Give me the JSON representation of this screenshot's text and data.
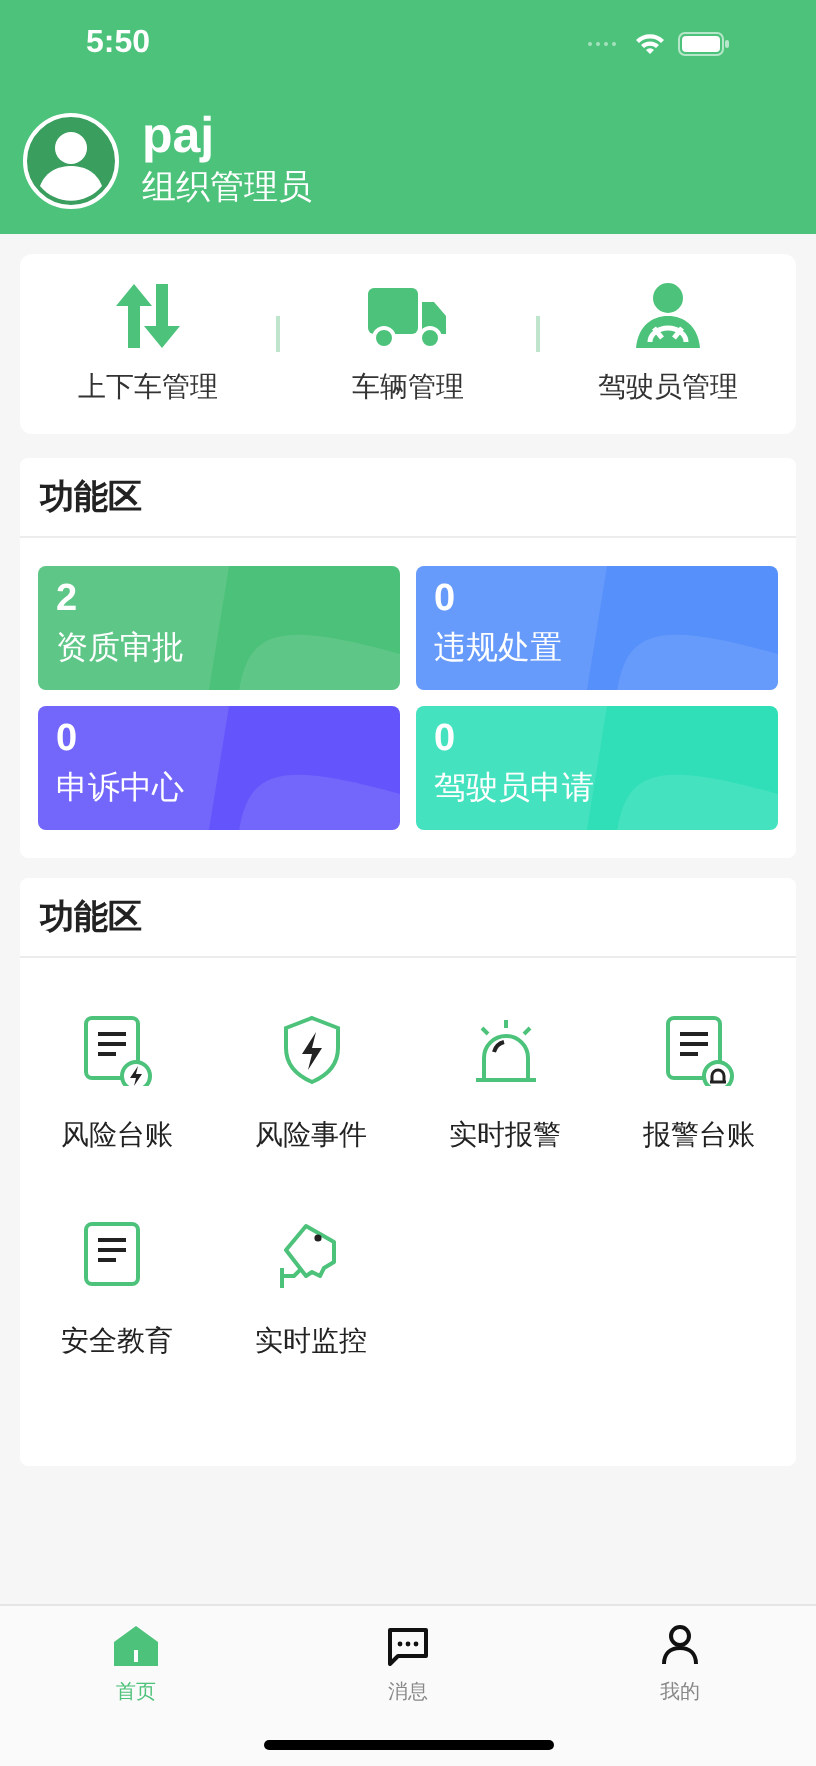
{
  "status_bar": {
    "time": "5:50"
  },
  "profile": {
    "name": "paj",
    "role": "组织管理员"
  },
  "quick_actions": [
    {
      "label": "上下车管理"
    },
    {
      "label": "车辆管理"
    },
    {
      "label": "驾驶员管理"
    }
  ],
  "stats_section": {
    "title": "功能区",
    "cards": [
      {
        "count": "2",
        "label": "资质审批",
        "color": "#4cc17a"
      },
      {
        "count": "0",
        "label": "违规处置",
        "color": "#5690fb"
      },
      {
        "count": "0",
        "label": "申诉中心",
        "color": "#6355fb"
      },
      {
        "count": "0",
        "label": "驾驶员申请",
        "color": "#30dfb8"
      }
    ]
  },
  "functions_section": {
    "title": "功能区",
    "items": [
      {
        "label": "风险台账"
      },
      {
        "label": "风险事件"
      },
      {
        "label": "实时报警"
      },
      {
        "label": "报警台账"
      },
      {
        "label": "安全教育"
      },
      {
        "label": "实时监控"
      }
    ]
  },
  "tab_bar": [
    {
      "label": "首页",
      "selected": true
    },
    {
      "label": "消息",
      "selected": false
    },
    {
      "label": "我的",
      "selected": false
    }
  ]
}
